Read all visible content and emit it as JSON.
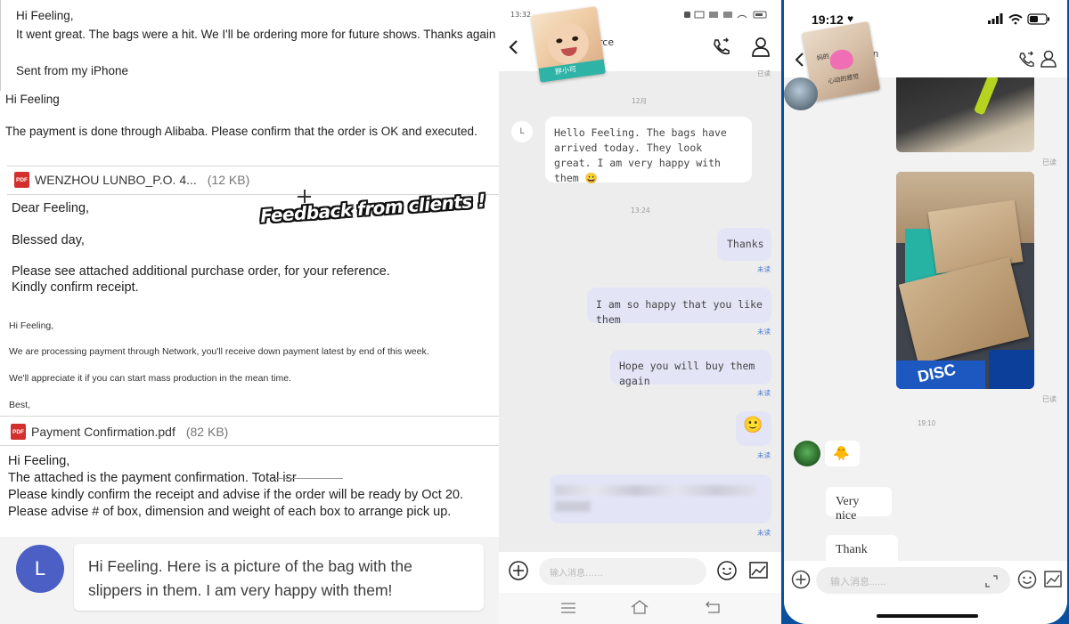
{
  "left": {
    "email1": {
      "greeting": "Hi Feeling,",
      "body": "It went great.  The bags were a hit.  We I'll be ordering more for future shows. Thanks again",
      "signature": "Sent from my iPhone"
    },
    "email2": {
      "greeting": "Hi Feeling",
      "body": "The payment is done through Alibaba. Please confirm that the order is OK and executed."
    },
    "attachment1": {
      "name": "WENZHOU LUNBO_P.O. 4...",
      "size": "(12 KB)"
    },
    "email3": {
      "greeting": "Dear Feeling,",
      "line2": "Blessed day,",
      "line3": "Please see attached additional purchase order, for your reference.",
      "line4": "Kindly confirm receipt."
    },
    "overlay_caption": "Feedback from clients !",
    "email4": {
      "greeting": "Hi Feeling,",
      "line1": "We are processing payment through Network, you'll receive down payment latest by end of this week.",
      "line2": "We'll appreciate it if you can start mass production in the mean time.",
      "line3": "Best,"
    },
    "attachment2": {
      "name": "Payment Confirmation.pdf",
      "size": "(82 KB)"
    },
    "email5": {
      "greeting": "Hi Feeling,",
      "line1": "The attached is the payment confirmation.  Total isr",
      "line2": "Please kindly confirm the receipt and advise if the order will be ready by Oct 20.",
      "line3": "Please advise # of box, dimension and weight of each box to arrange pick up."
    },
    "chat": {
      "avatar_letter": "L",
      "message": "Hi Feeling. Here is a picture of the bag with the slippers in them. I am very happy with them!"
    }
  },
  "mid": {
    "status_time": "13:32",
    "title_fragment": "rce",
    "read_top": "已读",
    "date1": "12月",
    "avatar_letter": "L",
    "msg_in": "Hello Feeling. The bags have arrived today. They look great. I am very happy with them 😀",
    "time2": "13:24",
    "msg_thanks": "Thanks",
    "msg_happy": "I am so happy that you like them",
    "msg_hope": "Hope you will buy them again",
    "emoji": "🙂",
    "unread": "未读",
    "input_placeholder": "输入消息……",
    "sticker_caption": "胖小可"
  },
  "right": {
    "status_time": "19:12",
    "title_fragment": "n",
    "read1": "已读",
    "read2": "已读",
    "time": "19:10",
    "msg_very_nice": "Very nice",
    "msg_thank_you": "Thank you",
    "input_placeholder": "输入消息......",
    "sticker_caption1": "妈的",
    "sticker_caption2": "心动的感觉",
    "box_label": "DISC"
  }
}
